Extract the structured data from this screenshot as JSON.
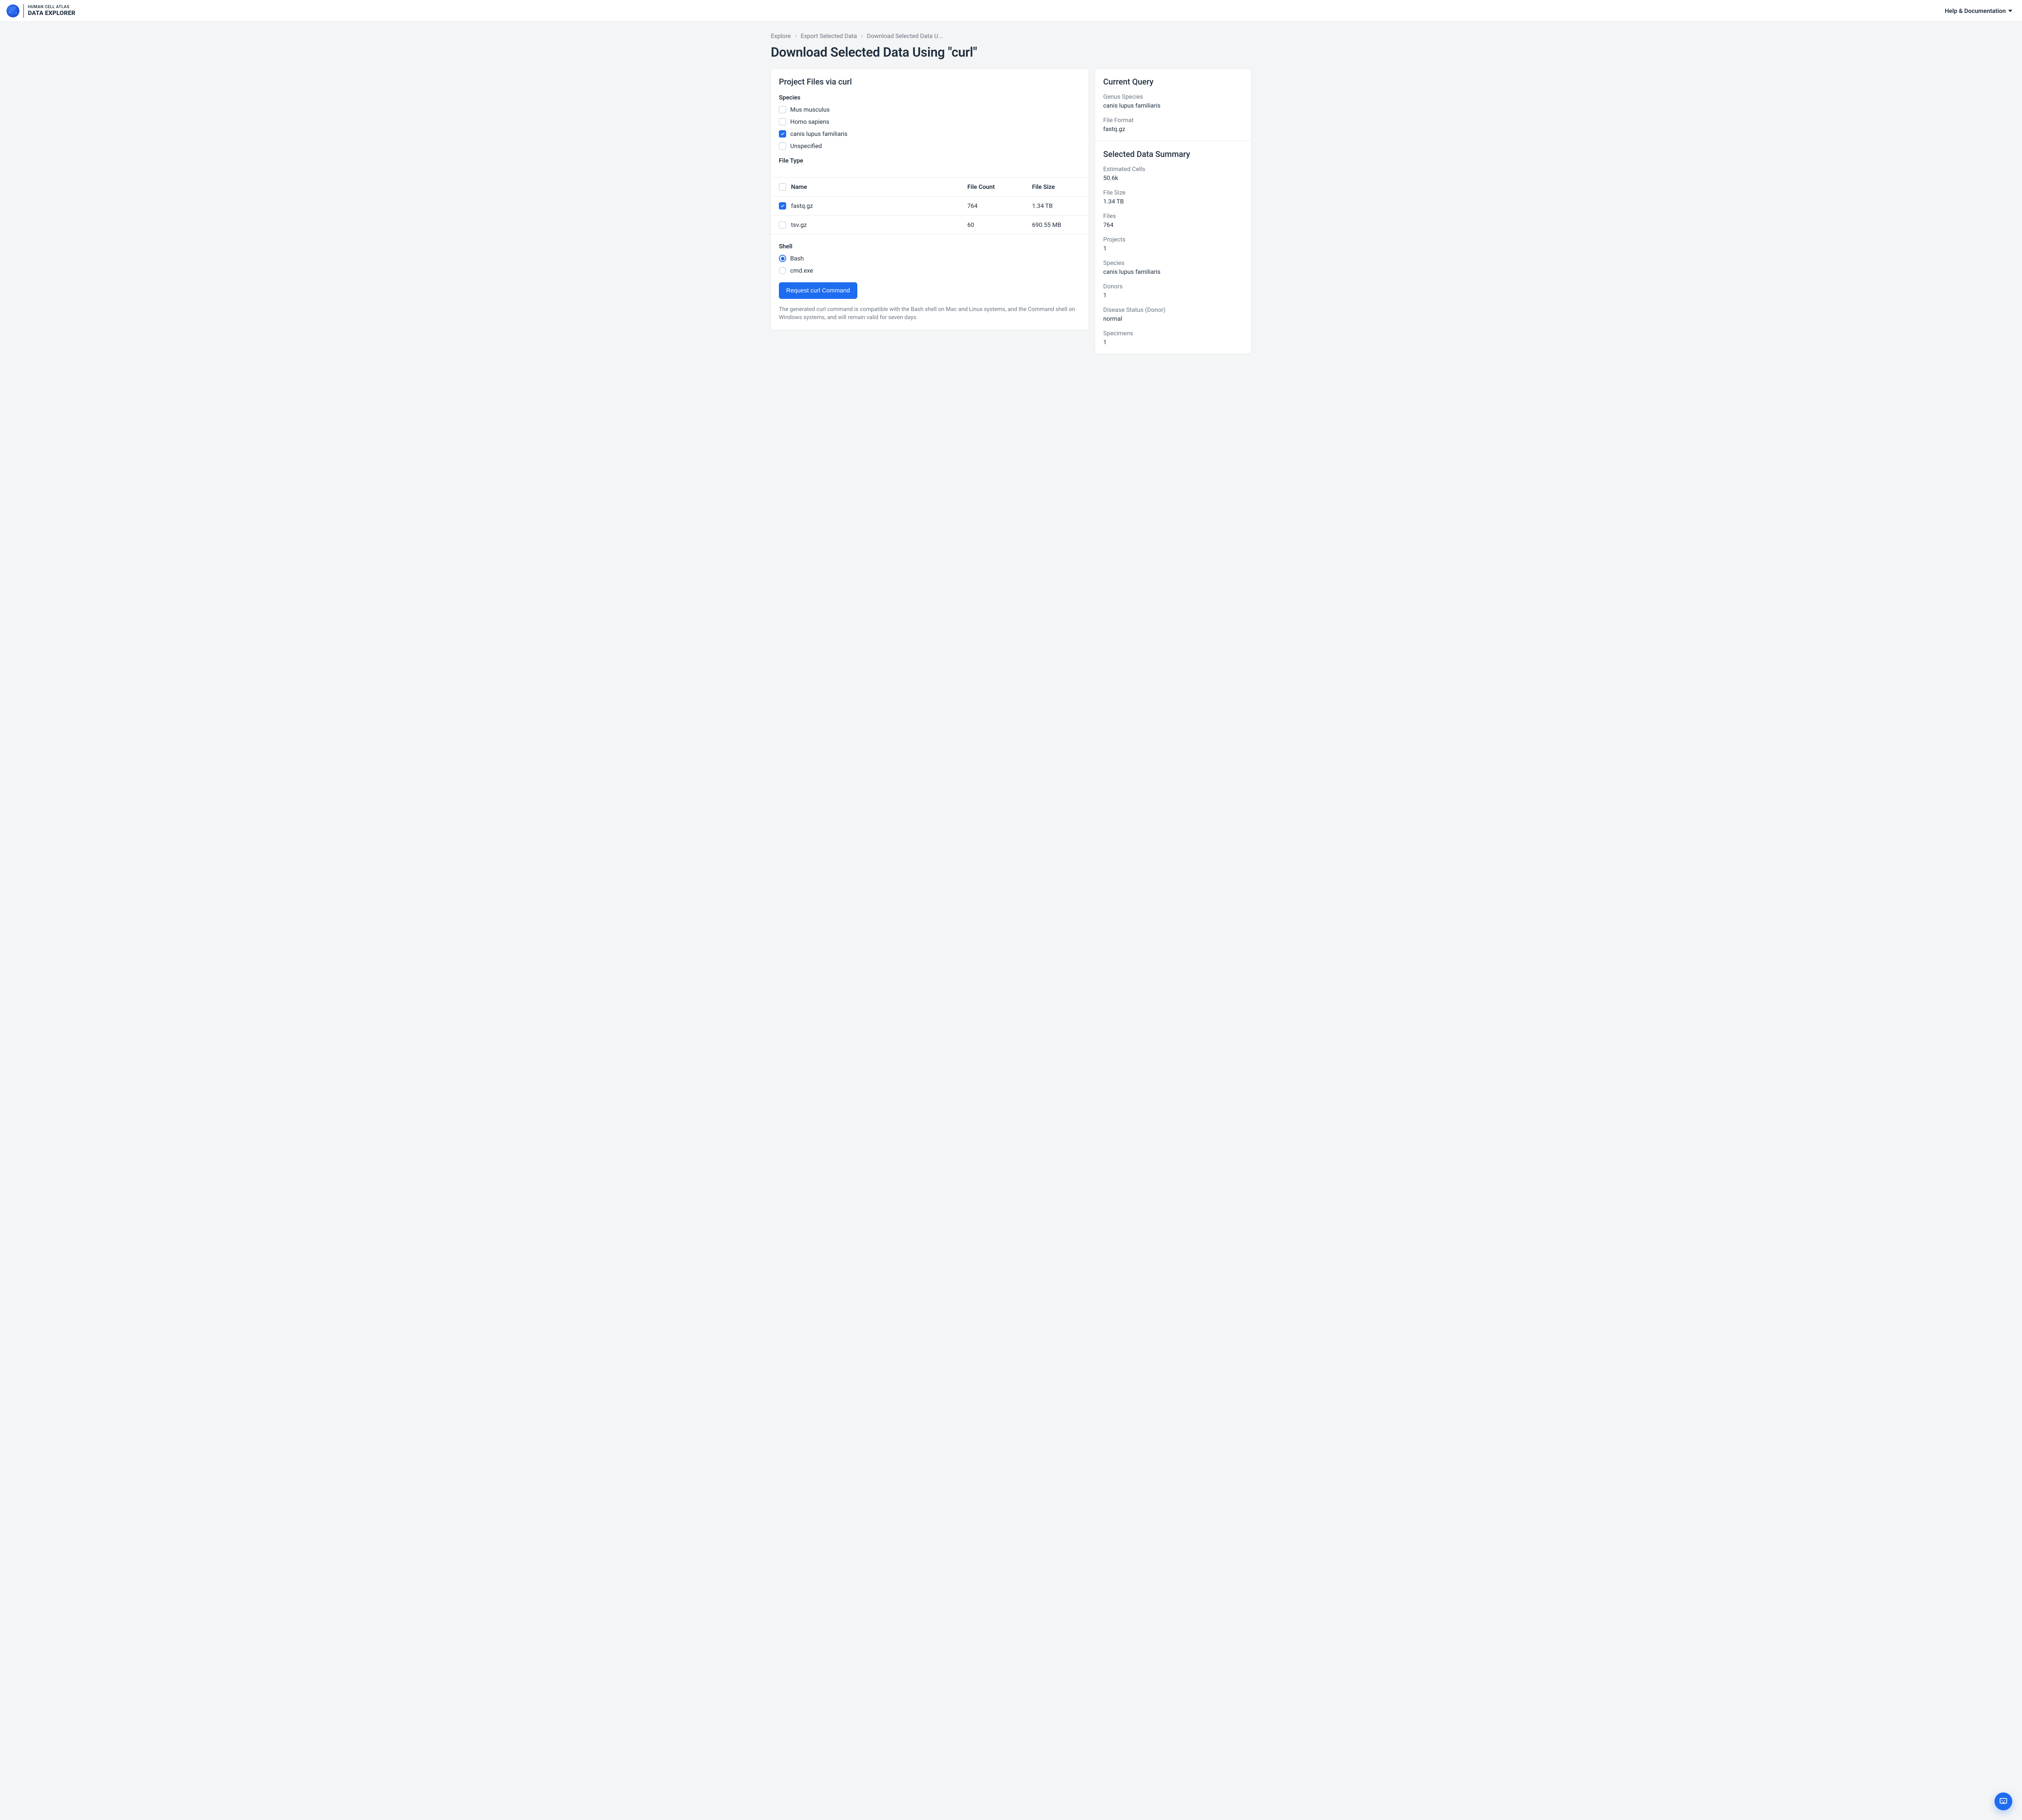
{
  "header": {
    "logo_line1": "HUMAN CELL ATLAS",
    "logo_line2": "DATA EXPLORER",
    "help_label": "Help & Documentation"
  },
  "breadcrumbs": {
    "items": [
      "Explore",
      "Export Selected Data",
      "Download Selected Data U..."
    ]
  },
  "page_title": "Download Selected Data Using \"curl\"",
  "left": {
    "section_title": "Project Files via curl",
    "species_label": "Species",
    "species": [
      {
        "label": "Mus musculus",
        "checked": false
      },
      {
        "label": "Homo sapiens",
        "checked": false
      },
      {
        "label": "canis lupus familiaris",
        "checked": true
      },
      {
        "label": "Unspecified",
        "checked": false
      }
    ],
    "filetype_label": "File Type",
    "table": {
      "cols": {
        "name": "Name",
        "count": "File Count",
        "size": "File Size"
      },
      "select_all_checked": false,
      "rows": [
        {
          "label": "fastq.gz",
          "count": "764",
          "size": "1.34 TB",
          "checked": true
        },
        {
          "label": "tsv.gz",
          "count": "60",
          "size": "690.55 MB",
          "checked": false
        }
      ]
    },
    "shell_label": "Shell",
    "shell_options": [
      {
        "label": "Bash",
        "selected": true
      },
      {
        "label": "cmd.exe",
        "selected": false
      }
    ],
    "request_button": "Request curl Command",
    "footnote": "The generated curl command is compatible with the Bash shell on Mac and Linux systems, and the Command shell on Windows systems, and will remain valid for seven days."
  },
  "right": {
    "query_title": "Current Query",
    "query_items": [
      {
        "key": "Genus Species",
        "val": "canis lupus familiaris"
      },
      {
        "key": "File Format",
        "val": "fastq.gz"
      }
    ],
    "summary_title": "Selected Data Summary",
    "summary_items": [
      {
        "key": "Estimated Cells",
        "val": "50.6k"
      },
      {
        "key": "File Size",
        "val": "1.34 TB"
      },
      {
        "key": "Files",
        "val": "764"
      },
      {
        "key": "Projects",
        "val": "1"
      },
      {
        "key": "Species",
        "val": "canis lupus familiaris"
      },
      {
        "key": "Donors",
        "val": "1"
      },
      {
        "key": "Disease Status (Donor)",
        "val": "normal"
      },
      {
        "key": "Specimens",
        "val": "1"
      }
    ]
  }
}
